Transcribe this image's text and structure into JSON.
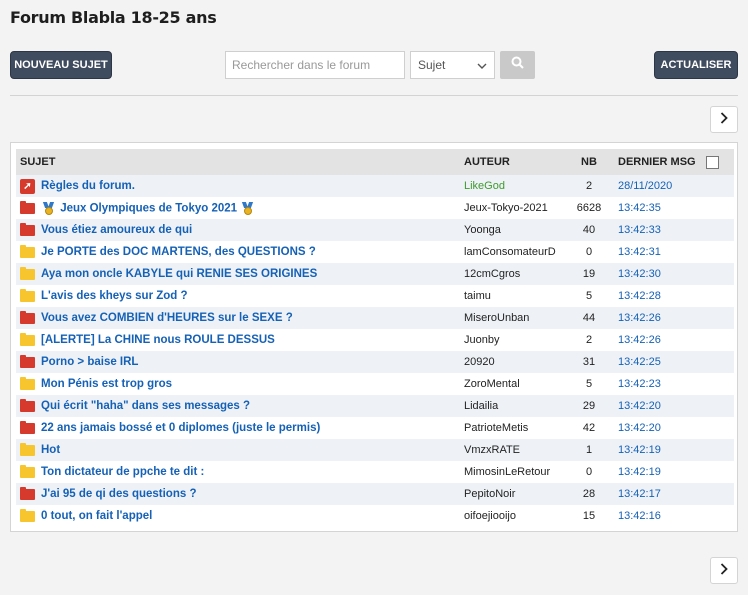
{
  "header": {
    "title": "Forum Blabla 18-25 ans"
  },
  "toolbar": {
    "new_topic_label": "NOUVEAU SUJET",
    "search_placeholder": "Rechercher dans le forum",
    "search_scope": "Sujet",
    "refresh_label": "ACTUALISER"
  },
  "table": {
    "headers": {
      "subject": "SUJET",
      "author": "AUTEUR",
      "count": "NB",
      "last": "DERNIER MSG"
    },
    "rows": [
      {
        "icon": "pin-icon",
        "subject": "Règles du forum.",
        "author": "LikeGod",
        "count": "2",
        "last": "28/11/2020"
      },
      {
        "icon": "folder-red-icon",
        "subject": "Jeux Olympiques de Tokyo 2021",
        "author": "Jeux-Tokyo-2021",
        "count": "6628",
        "last": "13:42:35"
      },
      {
        "icon": "folder-red-icon",
        "subject": "Vous étiez amoureux de qui",
        "author": "Yoonga",
        "count": "40",
        "last": "13:42:33"
      },
      {
        "icon": "folder-yellow-icon",
        "subject": "Je PORTE des DOC MARTENS, des QUESTIONS ?",
        "author": "lamConsomateurD",
        "count": "0",
        "last": "13:42:31"
      },
      {
        "icon": "folder-yellow-icon",
        "subject": "Aya mon oncle KABYLE qui RENIE SES ORIGINES",
        "author": "12cmCgros",
        "count": "19",
        "last": "13:42:30"
      },
      {
        "icon": "folder-yellow-icon",
        "subject": "L'avis des kheys sur Zod ?",
        "author": "taimu",
        "count": "5",
        "last": "13:42:28"
      },
      {
        "icon": "folder-red-icon",
        "subject": "Vous avez COMBIEN d'HEURES sur le SEXE ?",
        "author": "MiseroUnban",
        "count": "44",
        "last": "13:42:26"
      },
      {
        "icon": "folder-yellow-icon",
        "subject": "[ALERTE] La CHINE nous ROULE DESSUS",
        "author": "Juonby",
        "count": "2",
        "last": "13:42:26"
      },
      {
        "icon": "folder-red-icon",
        "subject": "Porno > baise IRL",
        "author": "20920",
        "count": "31",
        "last": "13:42:25"
      },
      {
        "icon": "folder-yellow-icon",
        "subject": "Mon Pénis est trop gros",
        "author": "ZoroMental",
        "count": "5",
        "last": "13:42:23"
      },
      {
        "icon": "folder-red-icon",
        "subject": "Qui écrit \"haha\" dans ses messages ?",
        "author": "Lidailia",
        "count": "29",
        "last": "13:42:20"
      },
      {
        "icon": "folder-red-icon",
        "subject": "22 ans jamais bossé et 0 diplomes (juste le permis)",
        "author": "PatrioteMetis",
        "count": "42",
        "last": "13:42:20"
      },
      {
        "icon": "folder-yellow-icon",
        "subject": "Hot",
        "author": "VmzxRATE",
        "count": "1",
        "last": "13:42:19"
      },
      {
        "icon": "folder-yellow-icon",
        "subject": "Ton dictateur de ppche te dit :",
        "author": "MimosinLeRetour",
        "count": "0",
        "last": "13:42:19"
      },
      {
        "icon": "folder-red-icon",
        "subject": "J'ai 95 de qi des questions ?",
        "author": "PepitoNoir",
        "count": "28",
        "last": "13:42:17"
      },
      {
        "icon": "folder-yellow-icon",
        "subject": "0 tout, on fait l'appel",
        "author": "oifoejiooijo",
        "count": "15",
        "last": "13:42:16"
      }
    ]
  },
  "colors": {
    "link": "#1561b6",
    "admin": "#3f9a2b",
    "folder_red": "#d63a2c",
    "folder_yellow": "#f7c62f",
    "dark_button": "#3f4b5e"
  }
}
